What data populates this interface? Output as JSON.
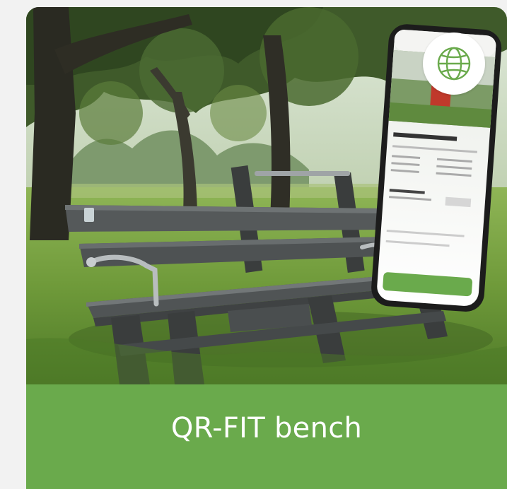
{
  "card": {
    "title": "QR-FIT bench",
    "link_icon": "globe-icon",
    "image_subject": "park-bench-with-smartphone-photo"
  },
  "colors": {
    "caption_bg": "#6aaa4c",
    "caption_text": "#ffffff",
    "icon_stroke": "#6aaa4c",
    "page_bg": "#f2f2f2"
  }
}
